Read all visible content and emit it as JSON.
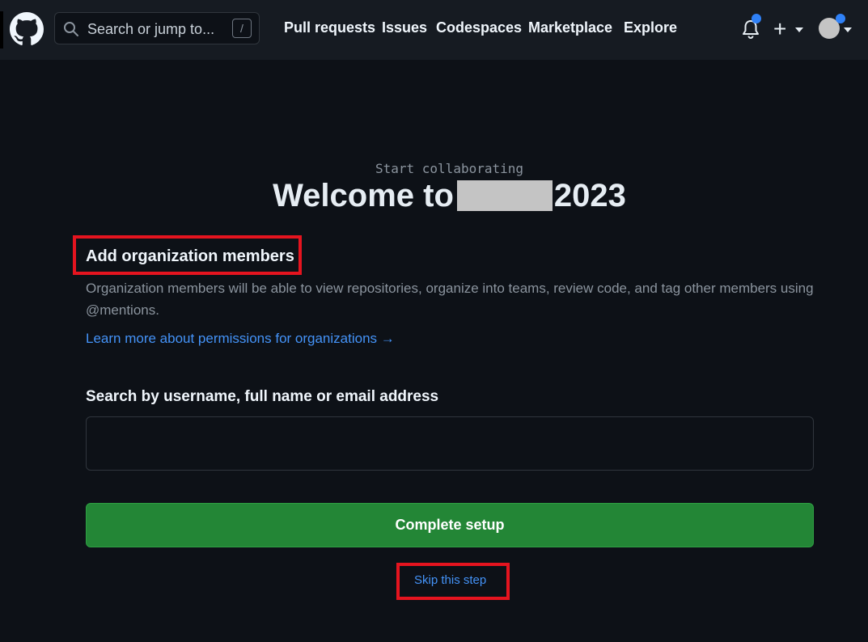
{
  "header": {
    "search_placeholder": "Search or jump to...",
    "search_shortcut": "/",
    "nav": [
      "Pull requests",
      "Issues",
      "Codespaces",
      "Marketplace",
      "Explore"
    ],
    "create_symbol": "+"
  },
  "icons": {
    "logo": "github-octocat-icon",
    "search": "search-icon",
    "notifications": "bell-icon",
    "create": "plus-icon",
    "dropdown": "caret-down-icon"
  },
  "main": {
    "eyebrow": "Start collaborating",
    "title_prefix": "Welcome to",
    "title_suffix": "2023",
    "section_title": "Add organization members",
    "description": "Organization members will be able to view repositories, organize into teams, review code, and tag other members using @mentions.",
    "learn_more": "Learn more about permissions for organizations →",
    "search_label": "Search by username, full name or email address",
    "search_value": "",
    "complete_button": "Complete setup",
    "skip_link": "Skip this step"
  },
  "colors": {
    "background": "#0d1117",
    "header": "#161b22",
    "link": "#4493f8",
    "primary_button": "#238636",
    "notification_dot": "#2f81f7",
    "highlight_box": "#e5141f"
  }
}
